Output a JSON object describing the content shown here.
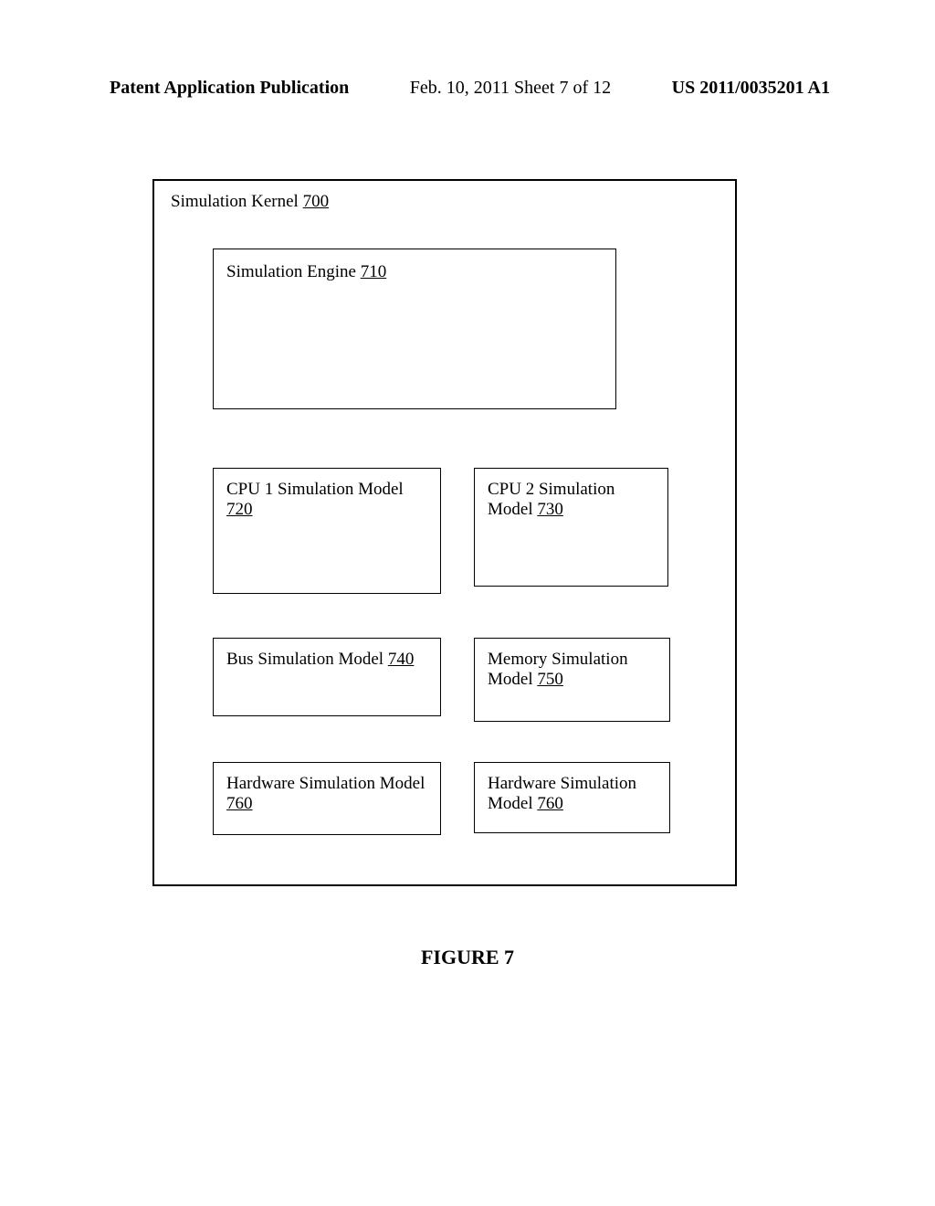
{
  "header": {
    "left": "Patent Application Publication",
    "center": "Feb. 10, 2011  Sheet 7 of 12",
    "right": "US 2011/0035201 A1"
  },
  "kernel": {
    "label_text": "Simulation Kernel ",
    "label_ref": "700"
  },
  "engine": {
    "label_text": "Simulation Engine ",
    "label_ref": "710"
  },
  "row1": {
    "left": {
      "text": "CPU 1 Simulation Model ",
      "ref": "720"
    },
    "right": {
      "text": "CPU 2 Simulation Model ",
      "ref": "730"
    }
  },
  "row2": {
    "left": {
      "text": "Bus Simulation Model ",
      "ref": "740"
    },
    "right": {
      "text": "Memory Simulation Model ",
      "ref": "750"
    }
  },
  "row3": {
    "left": {
      "text": "Hardware Simulation Model ",
      "ref": "760"
    },
    "right": {
      "text": "Hardware Simulation Model ",
      "ref": "760"
    }
  },
  "figure": {
    "label": "FIGURE 7"
  }
}
